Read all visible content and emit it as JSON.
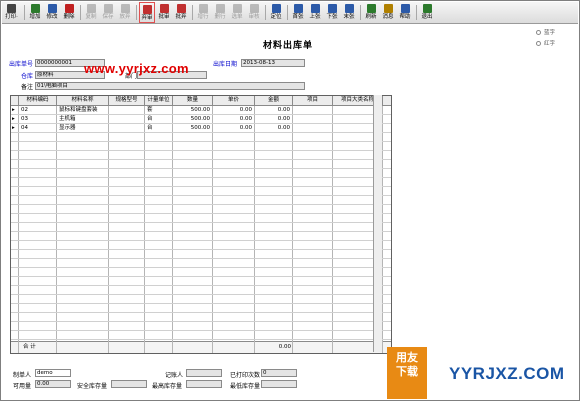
{
  "toolbar": {
    "buttons": [
      {
        "label": "打印·",
        "icon": "printer-icon",
        "disabled": false
      },
      {
        "label": "增加",
        "icon": "add-doc-icon",
        "disabled": false
      },
      {
        "label": "修改",
        "icon": "edit-icon",
        "disabled": false
      },
      {
        "label": "删除",
        "icon": "delete-icon",
        "disabled": false
      },
      {
        "label": "复制",
        "icon": "copy-icon",
        "disabled": true
      },
      {
        "label": "保存",
        "icon": "save-icon",
        "disabled": true
      },
      {
        "label": "放弃",
        "icon": "cancel-icon",
        "disabled": true
      },
      {
        "label": "弃审",
        "icon": "unaudit-icon",
        "disabled": false,
        "selected": true
      },
      {
        "label": "批审",
        "icon": "batch-audit-icon",
        "disabled": false
      },
      {
        "label": "批弃",
        "icon": "batch-unaudit-icon",
        "disabled": false
      },
      {
        "label": "增行",
        "icon": "add-row-icon",
        "disabled": true
      },
      {
        "label": "删行",
        "icon": "delete-row-icon",
        "disabled": true
      },
      {
        "label": "选单",
        "icon": "select-doc-icon",
        "disabled": true
      },
      {
        "label": "审核",
        "icon": "audit-icon",
        "disabled": true
      },
      {
        "label": "定位",
        "icon": "locate-icon",
        "disabled": false
      },
      {
        "label": "首张",
        "icon": "first-icon",
        "disabled": false
      },
      {
        "label": "上张",
        "icon": "prev-icon",
        "disabled": false
      },
      {
        "label": "下张",
        "icon": "next-icon",
        "disabled": false
      },
      {
        "label": "末张",
        "icon": "last-icon",
        "disabled": false
      },
      {
        "label": "刷新",
        "icon": "refresh-icon",
        "disabled": false
      },
      {
        "label": "消息",
        "icon": "message-icon",
        "disabled": false
      },
      {
        "label": "帮助",
        "icon": "help-icon",
        "disabled": false
      },
      {
        "label": "退出",
        "icon": "exit-icon",
        "disabled": false
      }
    ]
  },
  "form": {
    "title": "材料出库单",
    "doc_no_label": "出库单号",
    "doc_no": "0000000001",
    "date_label": "出库日期",
    "date": "2013-08-13",
    "warehouse_label": "仓库",
    "warehouse": "原材料",
    "dept_label": "部门",
    "dept": "",
    "remark_label": "备注",
    "remark": "01\\电脑项目",
    "radio_blue": "蓝字",
    "radio_red": "红字"
  },
  "watermark": "www.yyrjxz.com",
  "grid": {
    "headers": [
      "材料编码",
      "材料名称",
      "规格型号",
      "计量单位",
      "数量",
      "单价",
      "金额",
      "项目",
      "项目大类名称"
    ],
    "rows": [
      {
        "code": "02",
        "name": "鼠标和键盘套装",
        "spec": "",
        "unit": "套",
        "qty": "500.00",
        "price": "0.00",
        "amount": "0.00"
      },
      {
        "code": "03",
        "name": "主机箱",
        "spec": "",
        "unit": "台",
        "qty": "500.00",
        "price": "0.00",
        "amount": "0.00"
      },
      {
        "code": "04",
        "name": "显示器",
        "spec": "",
        "unit": "台",
        "qty": "500.00",
        "price": "0.00",
        "amount": "0.00"
      }
    ],
    "total_label": "合  计",
    "total_amount": "0.00"
  },
  "footer": {
    "maker_label": "制单人",
    "maker": "demo",
    "bookkeeper_label": "记账人",
    "bookkeeper": "",
    "printed_label": "已打印次数",
    "printed": "0",
    "available_label": "可用量",
    "available": "0.00",
    "safety_label": "安全库存量",
    "safety": "",
    "max_label": "最高库存量",
    "max": "",
    "min_label": "最低库存量",
    "min": ""
  },
  "logo": {
    "line1": "用友",
    "line2": "下载",
    "site": "YYRJXZ.COM"
  }
}
